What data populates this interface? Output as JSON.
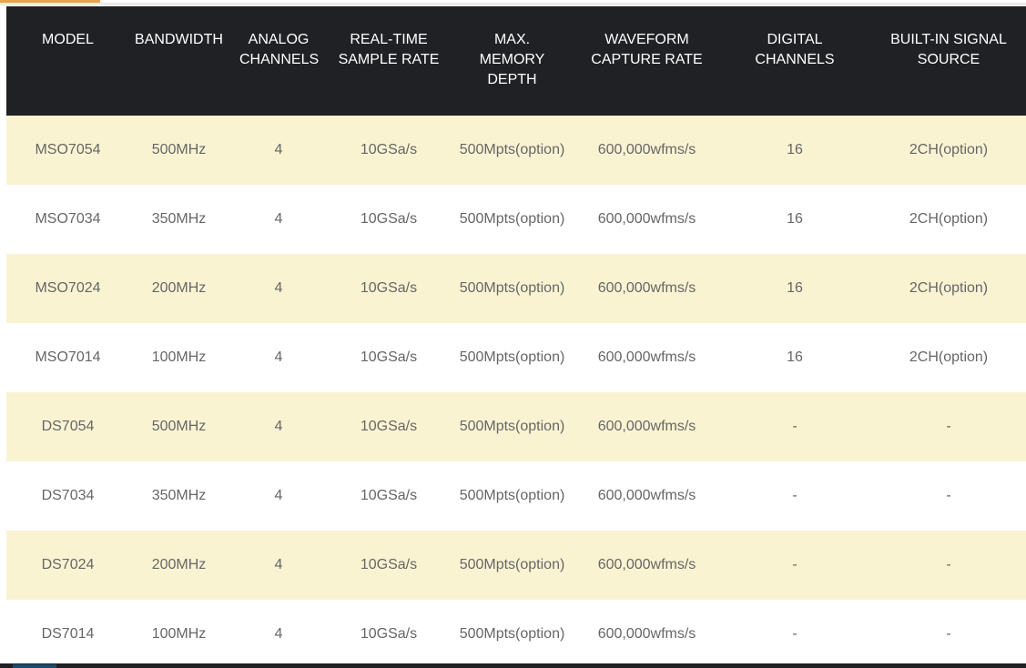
{
  "table": {
    "headers": [
      "MODEL",
      "BANDWIDTH",
      "ANALOG CHANNELS",
      "REAL-TIME SAMPLE RATE",
      "MAX. MEMORY DEPTH",
      "WAVEFORM CAPTURE RATE",
      "DIGITAL CHANNELS",
      "BUILT-IN SIGNAL SOURCE"
    ],
    "rows": [
      [
        "MSO7054",
        "500MHz",
        "4",
        "10GSa/s",
        "500Mpts(option)",
        "600,000wfms/s",
        "16",
        "2CH(option)"
      ],
      [
        "MSO7034",
        "350MHz",
        "4",
        "10GSa/s",
        "500Mpts(option)",
        "600,000wfms/s",
        "16",
        "2CH(option)"
      ],
      [
        "MSO7024",
        "200MHz",
        "4",
        "10GSa/s",
        "500Mpts(option)",
        "600,000wfms/s",
        "16",
        "2CH(option)"
      ],
      [
        "MSO7014",
        "100MHz",
        "4",
        "10GSa/s",
        "500Mpts(option)",
        "600,000wfms/s",
        "16",
        "2CH(option)"
      ],
      [
        "DS7054",
        "500MHz",
        "4",
        "10GSa/s",
        "500Mpts(option)",
        "600,000wfms/s",
        "-",
        "-"
      ],
      [
        "DS7034",
        "350MHz",
        "4",
        "10GSa/s",
        "500Mpts(option)",
        "600,000wfms/s",
        "-",
        "-"
      ],
      [
        "DS7024",
        "200MHz",
        "4",
        "10GSa/s",
        "500Mpts(option)",
        "600,000wfms/s",
        "-",
        "-"
      ],
      [
        "DS7014",
        "100MHz",
        "4",
        "10GSa/s",
        "500Mpts(option)",
        "600,000wfms/s",
        "-",
        "-"
      ]
    ]
  },
  "colors": {
    "header_bg": "#202124",
    "header_text": "#ffffff",
    "odd_row_bg": "#faf3d2",
    "even_row_bg": "#ffffff",
    "cell_text": "#666666",
    "accent": "#e8a44a"
  }
}
